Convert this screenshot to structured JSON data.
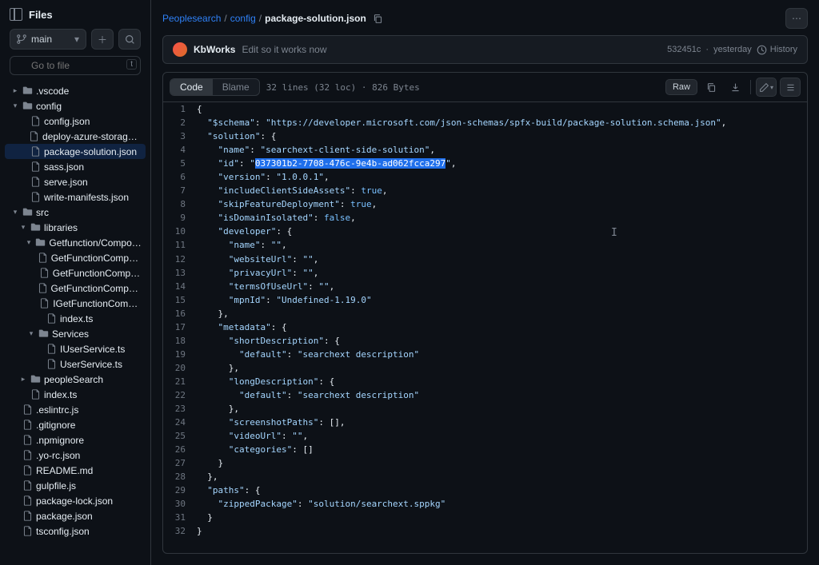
{
  "sidebar": {
    "title": "Files",
    "branch": "main",
    "search_placeholder": "Go to file",
    "kbd": "t",
    "tree": [
      {
        "type": "folder",
        "name": ".vscode",
        "depth": 0,
        "expanded": false
      },
      {
        "type": "folder",
        "name": "config",
        "depth": 0,
        "expanded": true
      },
      {
        "type": "file",
        "name": "config.json",
        "depth": 1
      },
      {
        "type": "file",
        "name": "deploy-azure-storage.json",
        "depth": 1
      },
      {
        "type": "file",
        "name": "package-solution.json",
        "depth": 1,
        "selected": true
      },
      {
        "type": "file",
        "name": "sass.json",
        "depth": 1
      },
      {
        "type": "file",
        "name": "serve.json",
        "depth": 1
      },
      {
        "type": "file",
        "name": "write-manifests.json",
        "depth": 1
      },
      {
        "type": "folder",
        "name": "src",
        "depth": 0,
        "expanded": true
      },
      {
        "type": "folder",
        "name": "libraries",
        "depth": 1,
        "expanded": true
      },
      {
        "type": "folder",
        "name": "Getfunction/Components",
        "depth": 2,
        "expanded": true
      },
      {
        "type": "file",
        "name": "GetFunctionComponent.mo…",
        "depth": 3
      },
      {
        "type": "file",
        "name": "GetFunctionComponent.tsx",
        "depth": 3
      },
      {
        "type": "file",
        "name": "GetFunctionComponentStat…",
        "depth": 3
      },
      {
        "type": "file",
        "name": "IGetFunctionComponent.ts",
        "depth": 3
      },
      {
        "type": "file",
        "name": "index.ts",
        "depth": 3
      },
      {
        "type": "folder",
        "name": "Services",
        "depth": 2,
        "expanded": true
      },
      {
        "type": "file",
        "name": "IUserService.ts",
        "depth": 3
      },
      {
        "type": "file",
        "name": "UserService.ts",
        "depth": 3
      },
      {
        "type": "folder",
        "name": "peopleSearch",
        "depth": 1,
        "expanded": false
      },
      {
        "type": "file",
        "name": "index.ts",
        "depth": 1
      },
      {
        "type": "file",
        "name": ".eslintrc.js",
        "depth": 0
      },
      {
        "type": "file",
        "name": ".gitignore",
        "depth": 0
      },
      {
        "type": "file",
        "name": ".npmignore",
        "depth": 0
      },
      {
        "type": "file",
        "name": ".yo-rc.json",
        "depth": 0
      },
      {
        "type": "file",
        "name": "README.md",
        "depth": 0
      },
      {
        "type": "file",
        "name": "gulpfile.js",
        "depth": 0
      },
      {
        "type": "file",
        "name": "package-lock.json",
        "depth": 0
      },
      {
        "type": "file",
        "name": "package.json",
        "depth": 0
      },
      {
        "type": "file",
        "name": "tsconfig.json",
        "depth": 0
      }
    ]
  },
  "breadcrumb": {
    "repo": "Peoplesearch",
    "dir": "config",
    "file": "package-solution.json"
  },
  "commit": {
    "author": "KbWorks",
    "message": "Edit so it works now",
    "hash": "532451c",
    "time": "yesterday",
    "history_label": "History"
  },
  "toolbar": {
    "code_label": "Code",
    "blame_label": "Blame",
    "file_info": "32 lines (32 loc) · 826 Bytes",
    "raw_label": "Raw"
  },
  "code": {
    "lines": [
      [
        {
          "t": "c",
          "v": "{"
        }
      ],
      [
        {
          "t": "c",
          "v": "  "
        },
        {
          "t": "p",
          "v": "\"$schema\""
        },
        {
          "t": "c",
          "v": ": "
        },
        {
          "t": "s",
          "v": "\"https://developer.microsoft.com/json-schemas/spfx-build/package-solution.schema.json\""
        },
        {
          "t": "c",
          "v": ","
        }
      ],
      [
        {
          "t": "c",
          "v": "  "
        },
        {
          "t": "p",
          "v": "\"solution\""
        },
        {
          "t": "c",
          "v": ": {"
        }
      ],
      [
        {
          "t": "c",
          "v": "    "
        },
        {
          "t": "p",
          "v": "\"name\""
        },
        {
          "t": "c",
          "v": ": "
        },
        {
          "t": "s",
          "v": "\"searchext-client-side-solution\""
        },
        {
          "t": "c",
          "v": ","
        }
      ],
      [
        {
          "t": "c",
          "v": "    "
        },
        {
          "t": "p",
          "v": "\"id\""
        },
        {
          "t": "c",
          "v": ": "
        },
        {
          "t": "s",
          "v": "\""
        },
        {
          "t": "sel",
          "v": "037301b2-7708-476c-9e4b-ad062fcca297"
        },
        {
          "t": "s",
          "v": "\""
        },
        {
          "t": "c",
          "v": ","
        }
      ],
      [
        {
          "t": "c",
          "v": "    "
        },
        {
          "t": "p",
          "v": "\"version\""
        },
        {
          "t": "c",
          "v": ": "
        },
        {
          "t": "s",
          "v": "\"1.0.0.1\""
        },
        {
          "t": "c",
          "v": ","
        }
      ],
      [
        {
          "t": "c",
          "v": "    "
        },
        {
          "t": "p",
          "v": "\"includeClientSideAssets\""
        },
        {
          "t": "c",
          "v": ": "
        },
        {
          "t": "b",
          "v": "true"
        },
        {
          "t": "c",
          "v": ","
        }
      ],
      [
        {
          "t": "c",
          "v": "    "
        },
        {
          "t": "p",
          "v": "\"skipFeatureDeployment\""
        },
        {
          "t": "c",
          "v": ": "
        },
        {
          "t": "b",
          "v": "true"
        },
        {
          "t": "c",
          "v": ","
        }
      ],
      [
        {
          "t": "c",
          "v": "    "
        },
        {
          "t": "p",
          "v": "\"isDomainIsolated\""
        },
        {
          "t": "c",
          "v": ": "
        },
        {
          "t": "b",
          "v": "false"
        },
        {
          "t": "c",
          "v": ","
        }
      ],
      [
        {
          "t": "c",
          "v": "    "
        },
        {
          "t": "p",
          "v": "\"developer\""
        },
        {
          "t": "c",
          "v": ": {"
        }
      ],
      [
        {
          "t": "c",
          "v": "      "
        },
        {
          "t": "p",
          "v": "\"name\""
        },
        {
          "t": "c",
          "v": ": "
        },
        {
          "t": "s",
          "v": "\"\""
        },
        {
          "t": "c",
          "v": ","
        }
      ],
      [
        {
          "t": "c",
          "v": "      "
        },
        {
          "t": "p",
          "v": "\"websiteUrl\""
        },
        {
          "t": "c",
          "v": ": "
        },
        {
          "t": "s",
          "v": "\"\""
        },
        {
          "t": "c",
          "v": ","
        }
      ],
      [
        {
          "t": "c",
          "v": "      "
        },
        {
          "t": "p",
          "v": "\"privacyUrl\""
        },
        {
          "t": "c",
          "v": ": "
        },
        {
          "t": "s",
          "v": "\"\""
        },
        {
          "t": "c",
          "v": ","
        }
      ],
      [
        {
          "t": "c",
          "v": "      "
        },
        {
          "t": "p",
          "v": "\"termsOfUseUrl\""
        },
        {
          "t": "c",
          "v": ": "
        },
        {
          "t": "s",
          "v": "\"\""
        },
        {
          "t": "c",
          "v": ","
        }
      ],
      [
        {
          "t": "c",
          "v": "      "
        },
        {
          "t": "p",
          "v": "\"mpnId\""
        },
        {
          "t": "c",
          "v": ": "
        },
        {
          "t": "s",
          "v": "\"Undefined-1.19.0\""
        }
      ],
      [
        {
          "t": "c",
          "v": "    },"
        }
      ],
      [
        {
          "t": "c",
          "v": "    "
        },
        {
          "t": "p",
          "v": "\"metadata\""
        },
        {
          "t": "c",
          "v": ": {"
        }
      ],
      [
        {
          "t": "c",
          "v": "      "
        },
        {
          "t": "p",
          "v": "\"shortDescription\""
        },
        {
          "t": "c",
          "v": ": {"
        }
      ],
      [
        {
          "t": "c",
          "v": "        "
        },
        {
          "t": "p",
          "v": "\"default\""
        },
        {
          "t": "c",
          "v": ": "
        },
        {
          "t": "s",
          "v": "\"searchext description\""
        }
      ],
      [
        {
          "t": "c",
          "v": "      },"
        }
      ],
      [
        {
          "t": "c",
          "v": "      "
        },
        {
          "t": "p",
          "v": "\"longDescription\""
        },
        {
          "t": "c",
          "v": ": {"
        }
      ],
      [
        {
          "t": "c",
          "v": "        "
        },
        {
          "t": "p",
          "v": "\"default\""
        },
        {
          "t": "c",
          "v": ": "
        },
        {
          "t": "s",
          "v": "\"searchext description\""
        }
      ],
      [
        {
          "t": "c",
          "v": "      },"
        }
      ],
      [
        {
          "t": "c",
          "v": "      "
        },
        {
          "t": "p",
          "v": "\"screenshotPaths\""
        },
        {
          "t": "c",
          "v": ": [],"
        }
      ],
      [
        {
          "t": "c",
          "v": "      "
        },
        {
          "t": "p",
          "v": "\"videoUrl\""
        },
        {
          "t": "c",
          "v": ": "
        },
        {
          "t": "s",
          "v": "\"\""
        },
        {
          "t": "c",
          "v": ","
        }
      ],
      [
        {
          "t": "c",
          "v": "      "
        },
        {
          "t": "p",
          "v": "\"categories\""
        },
        {
          "t": "c",
          "v": ": []"
        }
      ],
      [
        {
          "t": "c",
          "v": "    }"
        }
      ],
      [
        {
          "t": "c",
          "v": "  },"
        }
      ],
      [
        {
          "t": "c",
          "v": "  "
        },
        {
          "t": "p",
          "v": "\"paths\""
        },
        {
          "t": "c",
          "v": ": {"
        }
      ],
      [
        {
          "t": "c",
          "v": "    "
        },
        {
          "t": "p",
          "v": "\"zippedPackage\""
        },
        {
          "t": "c",
          "v": ": "
        },
        {
          "t": "s",
          "v": "\"solution/searchext.sppkg\""
        }
      ],
      [
        {
          "t": "c",
          "v": "  }"
        }
      ],
      [
        {
          "t": "c",
          "v": "}"
        }
      ]
    ]
  }
}
